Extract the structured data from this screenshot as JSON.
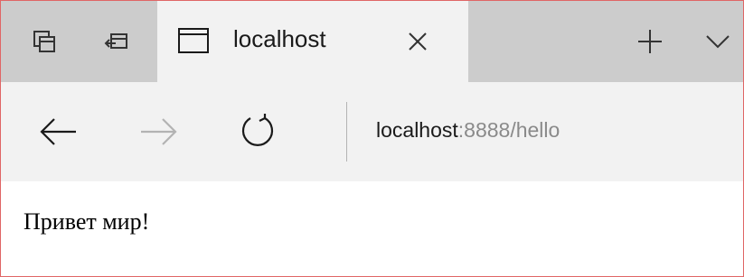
{
  "tab": {
    "title": "localhost"
  },
  "address_bar": {
    "host": "localhost",
    "rest": ":8888/hello"
  },
  "page": {
    "text": "Привет мир!"
  },
  "icons": {
    "tab_preview": "tabs-preview-icon",
    "set_aside": "set-aside-tabs-icon",
    "page": "page-icon",
    "close_tab": "close-icon",
    "new_tab": "plus-icon",
    "tab_list": "chevron-down-icon",
    "back": "back-arrow-icon",
    "forward": "forward-arrow-icon",
    "refresh": "refresh-icon"
  },
  "colors": {
    "tabbar_bg": "#cccccc",
    "active_tab_bg": "#f2f2f2",
    "address_host": "#1a1a1a",
    "address_rest": "#8a8a8a",
    "border": "#e06666"
  }
}
